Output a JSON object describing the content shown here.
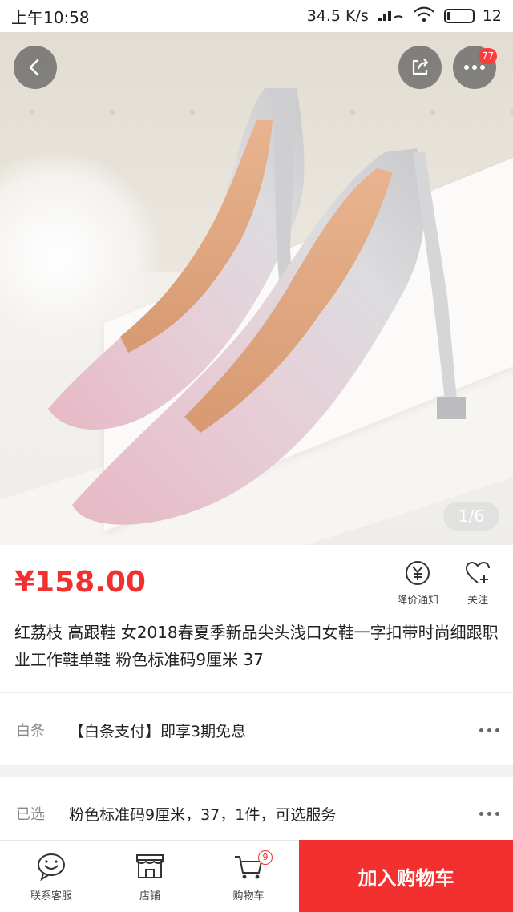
{
  "status_bar": {
    "time": "上午10:58",
    "speed": "34.5 K/s",
    "battery": "12"
  },
  "gallery": {
    "counter": "1/6",
    "message_badge": "77"
  },
  "product": {
    "price": "¥158.00",
    "title": "红荔枝 高跟鞋 女2018春夏季新品尖头浅口女鞋一字扣带时尚细跟职业工作鞋单鞋 粉色标准码9厘米 37"
  },
  "actions": {
    "notify_label": "降价通知",
    "follow_label": "关注"
  },
  "baitiao": {
    "label": "白条",
    "value": "【白条支付】即享3期免息"
  },
  "selected": {
    "label": "已选",
    "value": "粉色标准码9厘米，37，1件，可选服务"
  },
  "bottom_bar": {
    "service_label": "联系客服",
    "shop_label": "店铺",
    "cart_label": "购物车",
    "cart_count": "9",
    "add_to_cart": "加入购物车"
  },
  "colors": {
    "accent": "#f23030"
  }
}
